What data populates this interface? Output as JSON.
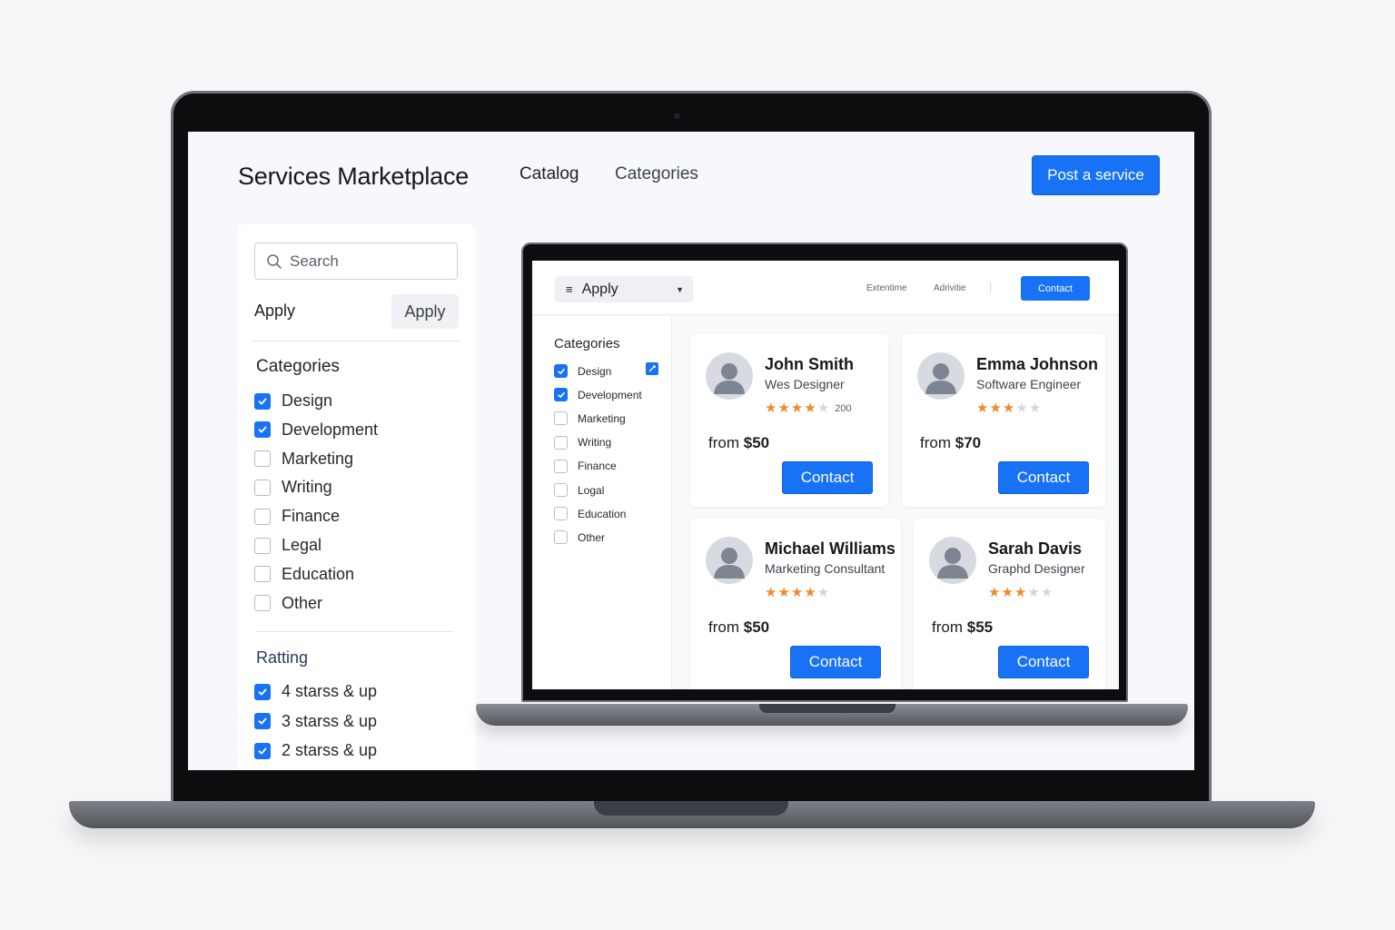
{
  "header": {
    "brand": "Services Marketplace",
    "nav": [
      "Catalog",
      "Categories"
    ],
    "post_button": "Post a service"
  },
  "filters": {
    "search_placeholder": "Search",
    "apply_label": "Apply",
    "apply_button": "Apply",
    "categories_title": "Categories",
    "categories": [
      {
        "label": "Design",
        "checked": true
      },
      {
        "label": "Development",
        "checked": true
      },
      {
        "label": "Marketing",
        "checked": false
      },
      {
        "label": "Writing",
        "checked": false
      },
      {
        "label": "Finance",
        "checked": false
      },
      {
        "label": "Legal",
        "checked": false
      },
      {
        "label": "Education",
        "checked": false
      },
      {
        "label": "Other",
        "checked": false
      }
    ],
    "rating_title": "Ratting",
    "ratings": [
      {
        "label": "4 starss & up",
        "checked": true
      },
      {
        "label": "3 starss & up",
        "checked": true
      },
      {
        "label": "2 starss & up",
        "checked": true
      }
    ]
  },
  "inner": {
    "dropdown_label": "Apply",
    "links": [
      "Extentime",
      "Adrivitie"
    ],
    "contact_button": "Contact",
    "categories_title": "Categories",
    "categories": [
      {
        "label": "Design",
        "checked": true
      },
      {
        "label": "Development",
        "checked": true
      },
      {
        "label": "Marketing",
        "checked": false
      },
      {
        "label": "Writing",
        "checked": false
      },
      {
        "label": "Finance",
        "checked": false
      },
      {
        "label": "Logal",
        "checked": false
      },
      {
        "label": "Education",
        "checked": false
      },
      {
        "label": "Other",
        "checked": false
      }
    ],
    "cards": [
      {
        "name": "John Smith",
        "role": "Wes Designer",
        "rating": 3.5,
        "reviews": "200",
        "price_prefix": "from ",
        "price": "$50",
        "button": "Contact"
      },
      {
        "name": "Emma Johnson",
        "role": "Software Engineer",
        "rating": 3,
        "reviews": "",
        "price_prefix": "from ",
        "price": "$70",
        "button": "Contact"
      },
      {
        "name": "Michael Williams",
        "role": "Marketing Consultant",
        "rating": 4,
        "reviews": "",
        "price_prefix": "from ",
        "price": "$50",
        "button": "Contact"
      },
      {
        "name": "Sarah Davis",
        "role": "Graphd Designer",
        "rating": 3,
        "reviews": "",
        "price_prefix": "from ",
        "price": "$55",
        "button": "Contact"
      }
    ]
  },
  "colors": {
    "accent": "#1772f5",
    "star": "#f0892a"
  }
}
